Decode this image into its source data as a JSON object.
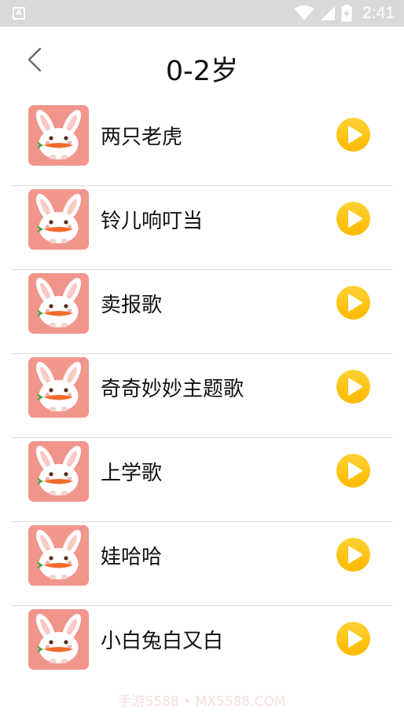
{
  "status_bar": {
    "time": "2:41",
    "notification_letter": "A",
    "icons": [
      "wifi-icon",
      "cell-signal-icon",
      "battery-charging-icon"
    ]
  },
  "header": {
    "title": "0-2岁",
    "back_icon": "chevron-left-icon"
  },
  "songs": [
    {
      "title": "两只老虎"
    },
    {
      "title": "铃儿响叮当"
    },
    {
      "title": "卖报歌"
    },
    {
      "title": "奇奇妙妙主题歌"
    },
    {
      "title": "上学歌"
    },
    {
      "title": "娃哈哈"
    },
    {
      "title": "小白兔白又白"
    }
  ],
  "thumbnail_icon": "bunny-carrot-icon",
  "play_icon": "play-circle-icon",
  "colors": {
    "thumbnail_bg": "#f2958b",
    "play_button": "#ffc21a",
    "divider": "#dcdcdc",
    "status_bar": "#d9d9d9"
  },
  "watermark": "手游5588 • MX5588.COM"
}
